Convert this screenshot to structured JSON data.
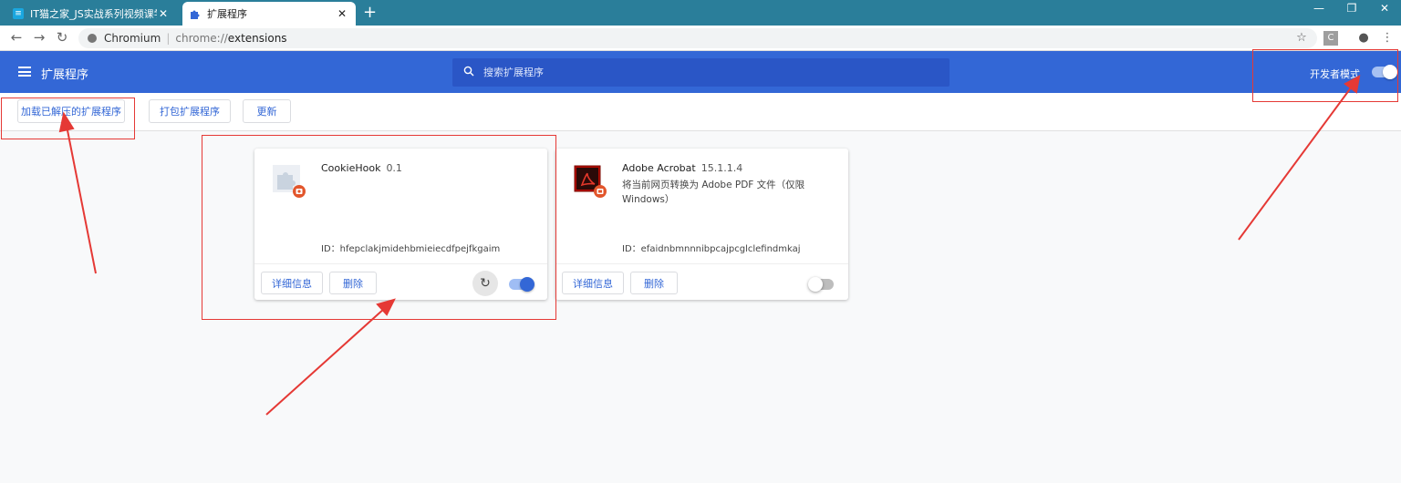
{
  "tabs": [
    {
      "title": "IT猫之家_JS实战系列视频课学_小",
      "active": false,
      "favicon": "page-icon"
    },
    {
      "title": "扩展程序",
      "active": true,
      "favicon": "puzzle-icon"
    }
  ],
  "address": {
    "origin": "Chromium",
    "scheme": "chrome://",
    "path": "extensions",
    "ext_badge": "C"
  },
  "header": {
    "title": "扩展程序",
    "search_placeholder": "搜索扩展程序",
    "dev_mode_label": "开发者模式",
    "dev_mode_on": true
  },
  "actions": {
    "load_unpacked": "加载已解压的扩展程序",
    "pack": "打包扩展程序",
    "update": "更新"
  },
  "extensions": [
    {
      "name": "CookieHook",
      "version": "0.1",
      "description": "",
      "id_line": "ID：hfepclakjmidehbmieiecdfpejfkgaim",
      "details_label": "详细信息",
      "remove_label": "删除",
      "enabled": true,
      "has_reload": true
    },
    {
      "name": "Adobe Acrobat",
      "version": "15.1.1.4",
      "description": "将当前网页转换为 Adobe PDF 文件（仅限 Windows）",
      "id_line": "ID：efaidnbmnnnibpcajpcglclefindmkaj",
      "details_label": "详细信息",
      "remove_label": "删除",
      "enabled": false,
      "has_reload": false
    }
  ],
  "colors": {
    "header": "#3367d6",
    "tabbar": "#2a7e9a",
    "annotation": "#e53935"
  }
}
